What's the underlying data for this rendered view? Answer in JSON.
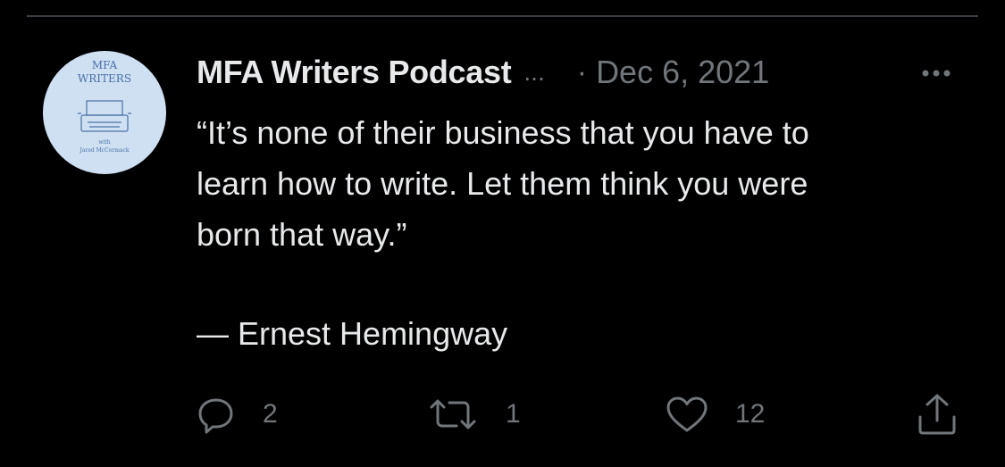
{
  "tweet": {
    "avatar": {
      "line1": "MFA",
      "line2": "WRITERS",
      "line3": "with",
      "line4": "Jared McCormack"
    },
    "author_name": "MFA Writers Podcast",
    "truncation": "...",
    "separator": "·",
    "date": "Dec 6, 2021",
    "text": "“It’s none of their business that you have to\nlearn how to write. Let them think you were\nborn that way.”",
    "attribution": "— Ernest Hemingway",
    "actions": {
      "reply_count": "2",
      "retweet_count": "1",
      "like_count": "12"
    }
  },
  "colors": {
    "background": "#000000",
    "primary_text": "#e7e9ea",
    "secondary_text": "#71767b",
    "avatar_bg": "#cfe0f3",
    "avatar_ink": "#4a6fa5"
  },
  "icons": {
    "more": "more-icon",
    "reply": "reply-icon",
    "retweet": "retweet-icon",
    "like": "heart-icon",
    "share": "share-icon"
  }
}
